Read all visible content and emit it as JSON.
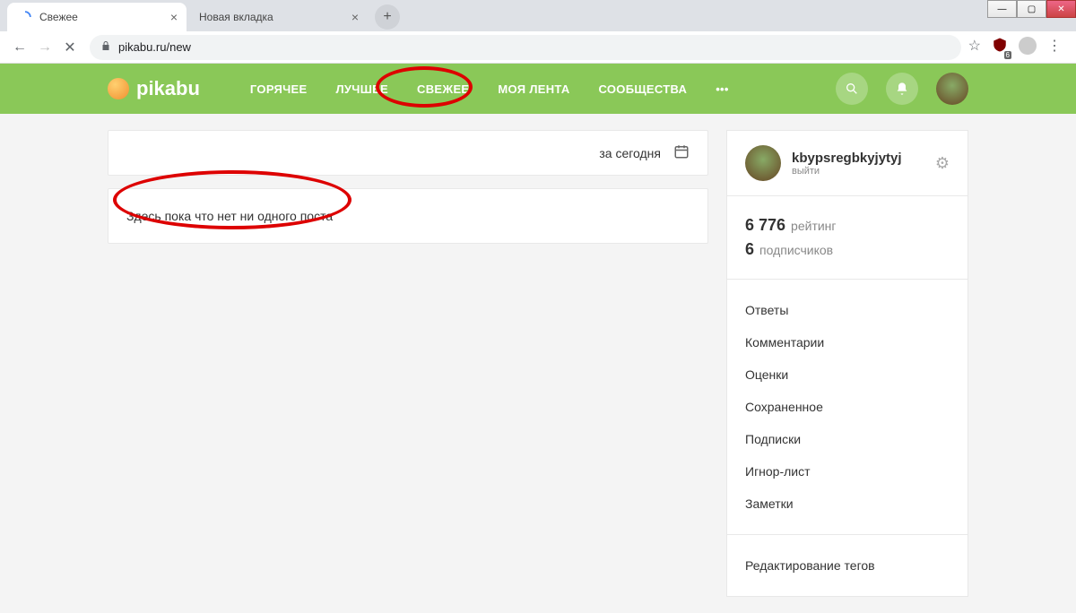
{
  "window": {
    "min": "—",
    "max": "▢",
    "close": "✕"
  },
  "tabs": [
    {
      "title": "Свежее",
      "active": true
    },
    {
      "title": "Новая вкладка",
      "active": false
    }
  ],
  "address": "pikabu.ru/new",
  "brand": "pikabu",
  "nav": {
    "items": [
      "ГОРЯЧЕЕ",
      "ЛУЧШЕЕ",
      "СВЕЖЕЕ",
      "МОЯ ЛЕНТА",
      "СООБЩЕСТВА"
    ],
    "more": "•••"
  },
  "filter": {
    "label": "за сегодня"
  },
  "empty_message": "Здесь пока что нет ни одного поста",
  "user": {
    "name": "kbypsregbkyjytyj",
    "logout": "выйти",
    "rating_value": "6 776",
    "rating_label": "рейтинг",
    "subs_value": "6",
    "subs_label": "подписчиков"
  },
  "side_links": [
    "Ответы",
    "Комментарии",
    "Оценки",
    "Сохраненное",
    "Подписки",
    "Игнор-лист",
    "Заметки"
  ],
  "side_edit_tags": "Редактирование тегов",
  "ext_badge": "6"
}
